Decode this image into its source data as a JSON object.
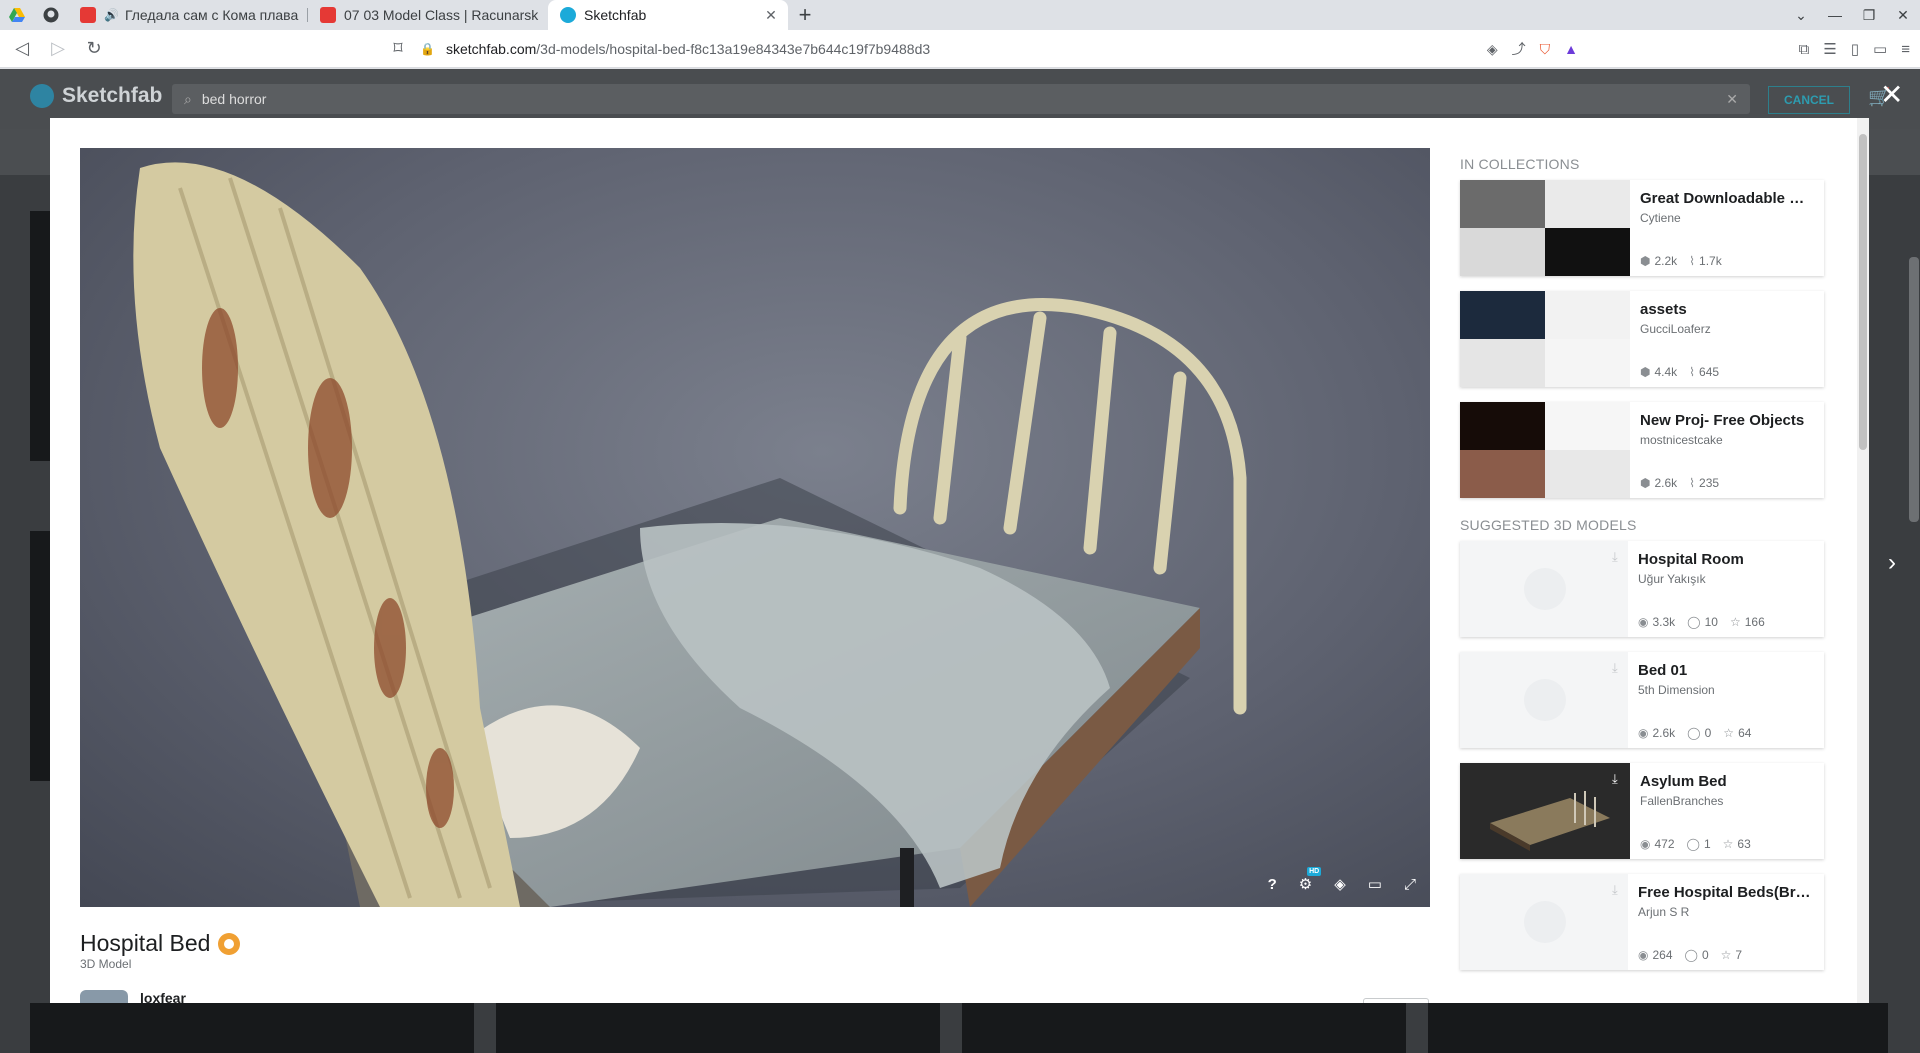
{
  "browser": {
    "tabs": [
      {
        "title": "Гледала сам с Кома плава",
        "color": "#e53935",
        "audio": true
      },
      {
        "title": "07 03 Model Class | Racunarsk",
        "color": "#e53935",
        "audio": false
      },
      {
        "title": "Sketchfab",
        "color": "#1caad9",
        "active": true
      }
    ],
    "url_host": "sketchfab.com",
    "url_path": "/3d-models/hospital-bed-f8c13a19e84343e7b644c19f7b9488d3"
  },
  "site": {
    "logo": "Sketchfab",
    "search_value": "bed horror",
    "cancel_label": "CANCEL"
  },
  "model": {
    "title": "Hospital Bed",
    "type": "3D Model",
    "author": "loxfear"
  },
  "collections": {
    "heading": "IN COLLECTIONS",
    "items": [
      {
        "title": "Great Downloadable Mo...",
        "owner": "Cytiene",
        "models": "2.2k",
        "followers": "1.7k"
      },
      {
        "title": "assets",
        "owner": "GucciLoaferz",
        "models": "4.4k",
        "followers": "645"
      },
      {
        "title": "New Proj- Free Objects",
        "owner": "mostnicestcake",
        "models": "2.6k",
        "followers": "235"
      }
    ]
  },
  "suggested": {
    "heading": "SUGGESTED 3D MODELS",
    "items": [
      {
        "title": "Hospital Room",
        "author": "Uğur Yakışık",
        "views": "3.3k",
        "comments": "10",
        "likes": "166"
      },
      {
        "title": "Bed 01",
        "author": "5th Dimension",
        "views": "2.6k",
        "comments": "0",
        "likes": "64"
      },
      {
        "title": "Asylum Bed",
        "author": "FallenBranches",
        "views": "472",
        "comments": "1",
        "likes": "63"
      },
      {
        "title": "Free Hospital Beds(Brok...",
        "author": "Arjun S R",
        "views": "264",
        "comments": "0",
        "likes": "7"
      }
    ]
  },
  "icons": {
    "help": "?",
    "hd_badge": "HD"
  }
}
